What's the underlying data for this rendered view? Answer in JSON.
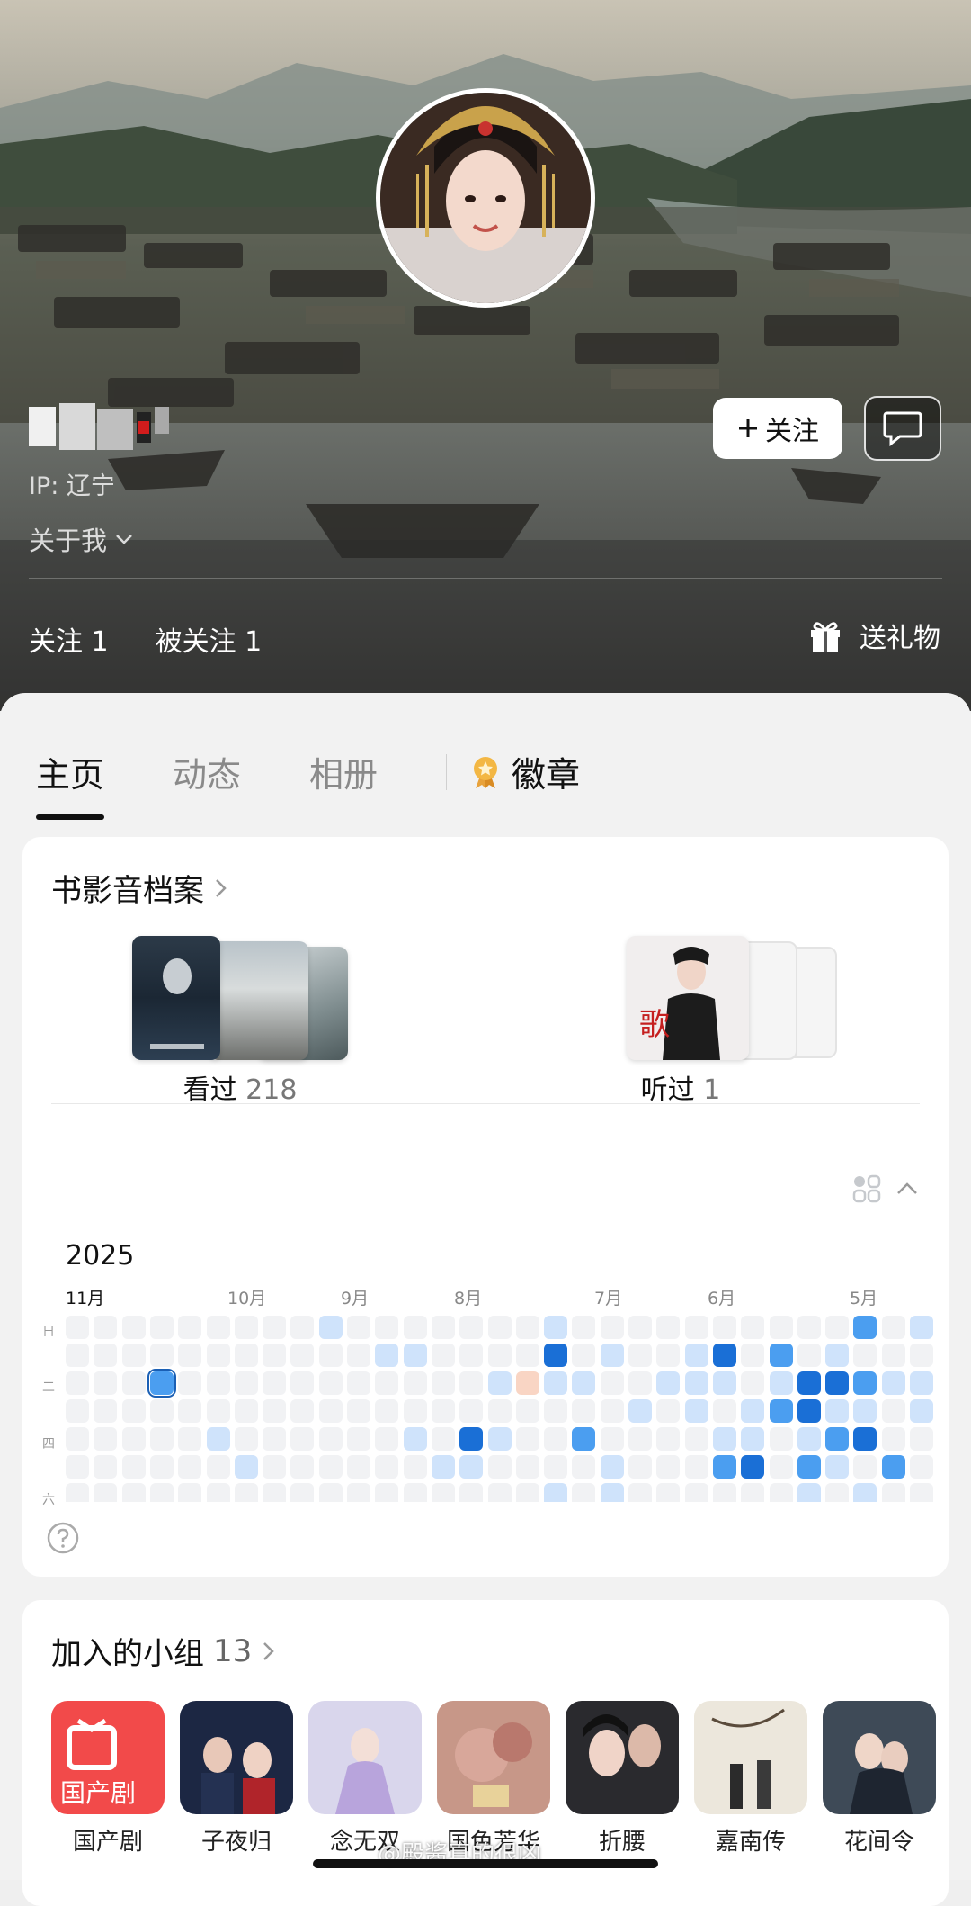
{
  "profile": {
    "ip": "IP: 辽宁",
    "about": "关于我",
    "follow_label": "关注",
    "following": "关注 1",
    "followers": "被关注 1",
    "gift": "送礼物"
  },
  "tabs": [
    {
      "label": "主页",
      "active": true
    },
    {
      "label": "动态",
      "active": false
    },
    {
      "label": "相册",
      "active": false
    },
    {
      "label": "徽章",
      "active": false
    }
  ],
  "archive": {
    "title": "书影音档案",
    "watched_label": "看过",
    "watched_count": "218",
    "listened_label": "听过",
    "listened_count": "1"
  },
  "heatmap": {
    "year": "2025",
    "months": [
      "11月",
      "10月",
      "9月",
      "8月",
      "7月",
      "6月",
      "5月"
    ],
    "weekdays": [
      "日",
      "二",
      "四",
      "六"
    ],
    "colors": {
      "empty": "#f1f2f4",
      "l1": "#cfe3fb",
      "l2": "#9cc8f7",
      "l3": "#4b9ef0",
      "l4": "#1a6fd6",
      "peach": "#f9d5c4"
    }
  },
  "groups": {
    "title": "加入的小组",
    "count": "13",
    "items": [
      {
        "name": "国产剧",
        "icon": "tv-icon"
      },
      {
        "name": "子夜归",
        "icon": "drama-poster"
      },
      {
        "name": "念无双",
        "icon": "drama-poster"
      },
      {
        "name": "国色芳华",
        "icon": "drama-poster"
      },
      {
        "name": "折腰",
        "icon": "drama-poster"
      },
      {
        "name": "嘉南传",
        "icon": "drama-poster"
      },
      {
        "name": "花间令",
        "icon": "drama-poster"
      }
    ]
  },
  "watermark": "@殿酱真的很凶"
}
